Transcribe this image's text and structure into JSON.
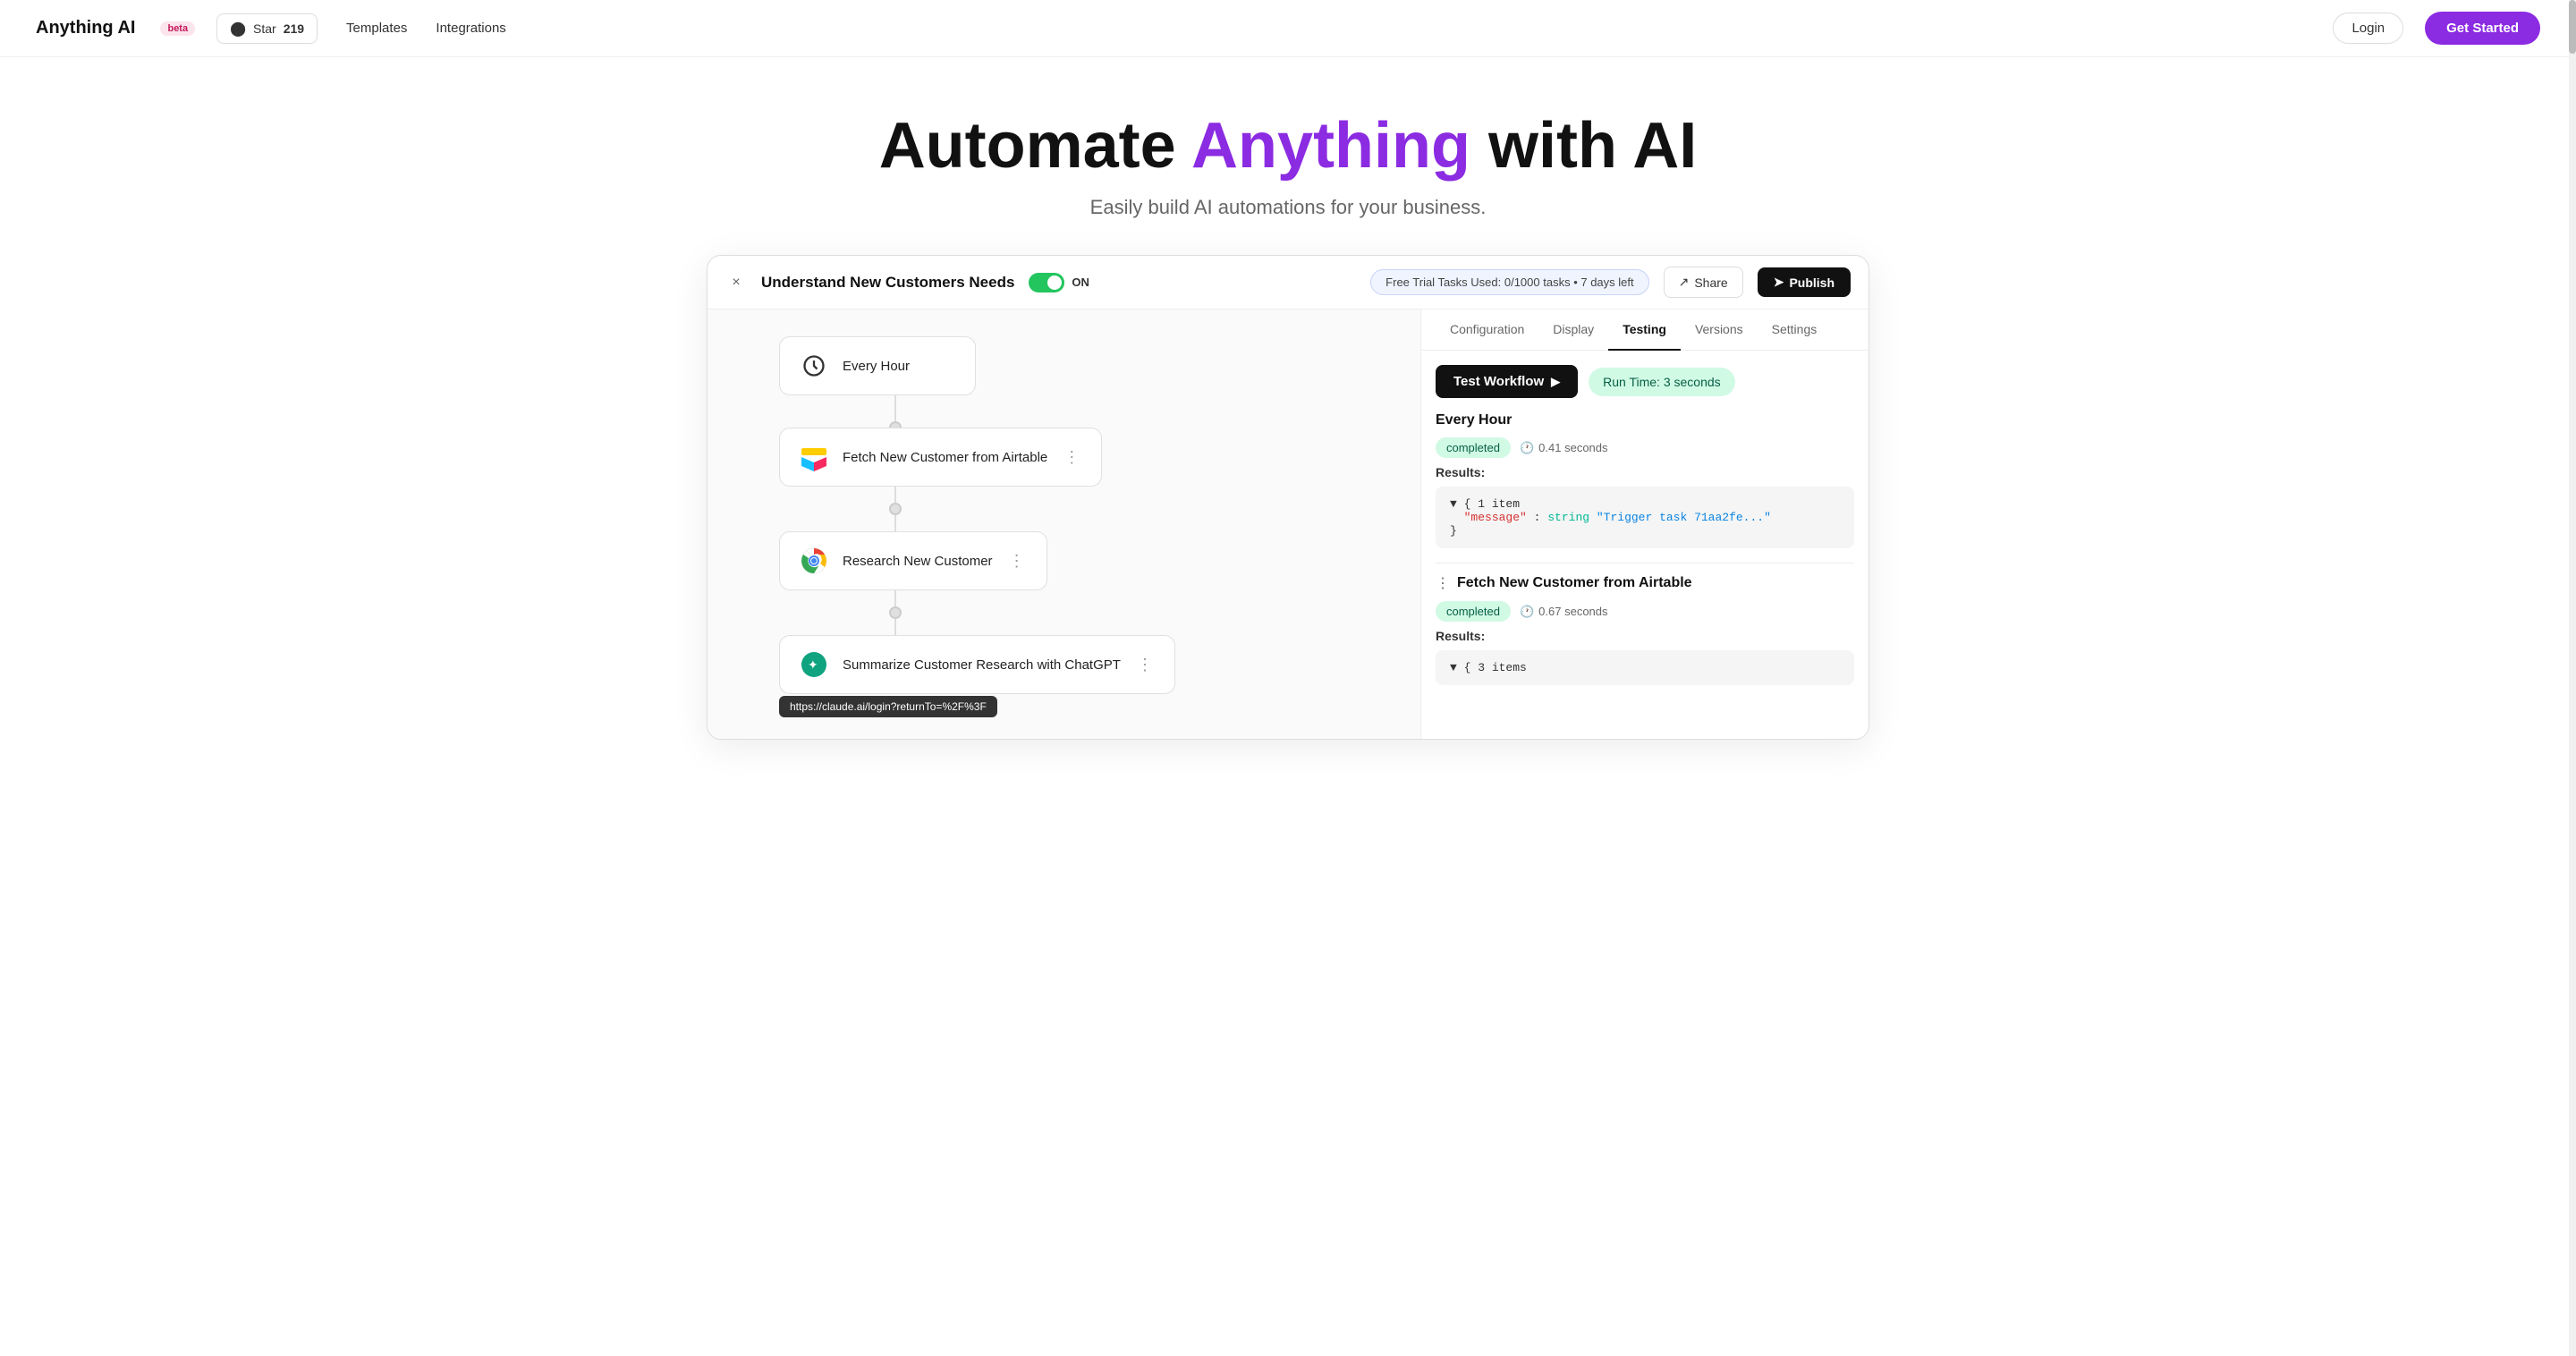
{
  "nav": {
    "logo": "Anything AI",
    "beta_label": "beta",
    "star_label": "Star",
    "star_count": "219",
    "templates_label": "Templates",
    "integrations_label": "Integrations",
    "login_label": "Login",
    "getstarted_label": "Get Started"
  },
  "hero": {
    "title_prefix": "Automate ",
    "title_accent": "Anything",
    "title_suffix": " with AI",
    "subtitle": "Easily build AI automations for your business."
  },
  "app": {
    "topbar": {
      "close_icon": "×",
      "workflow_title": "Understand New Customers Needs",
      "toggle_state": "ON",
      "trial_text": "Free Trial Tasks Used: 0/1000 tasks • 7 days left",
      "share_label": "Share",
      "publish_label": "Publish"
    },
    "canvas": {
      "nodes": [
        {
          "icon": "clock",
          "label": "Every Hour",
          "has_menu": false
        },
        {
          "icon": "airtable",
          "label": "Fetch New Customer from Airtable",
          "has_menu": true
        },
        {
          "icon": "chrome",
          "label": "Research New Customer",
          "has_menu": true
        },
        {
          "icon": "chatgpt",
          "label": "Summarize Customer Research with ChatGPT",
          "has_menu": true
        }
      ],
      "tooltip_url": "https://claude.ai/login?returnTo=%2F%3F"
    },
    "panel": {
      "tabs": [
        {
          "label": "Configuration",
          "active": false
        },
        {
          "label": "Display",
          "active": false
        },
        {
          "label": "Testing",
          "active": true
        },
        {
          "label": "Versions",
          "active": false
        },
        {
          "label": "Settings",
          "active": false
        }
      ],
      "test_workflow_label": "Test Workflow",
      "runtime_label": "Run Time: 3 seconds",
      "sections": [
        {
          "title": "Every Hour",
          "status": "completed",
          "time": "0.41 seconds",
          "results_label": "Results:",
          "code": "{ 1 item\n  \"message\" : string \"Trigger task 71aa2fe...\"\n}"
        },
        {
          "title": "Fetch New Customer from Airtable",
          "status": "completed",
          "time": "0.67 seconds",
          "results_label": "Results:",
          "code": "{ 3 items"
        }
      ]
    }
  }
}
